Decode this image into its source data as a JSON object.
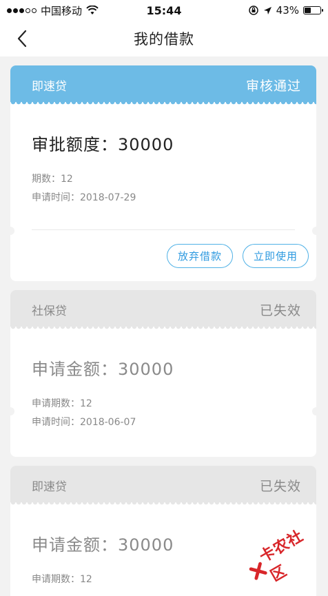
{
  "status_bar": {
    "carrier": "中国移动",
    "time": "15:44",
    "battery": "43%",
    "battery_level": 0.43
  },
  "nav": {
    "title": "我的借款"
  },
  "loans": [
    {
      "product": "即速贷",
      "status": "审核通过",
      "amount_label": "审批额度：",
      "amount": "30000",
      "term_label": "期数：",
      "term": "12",
      "date_label": "申请时间：",
      "date": "2018-07-29",
      "actions": [
        "放弃借款",
        "立即使用"
      ]
    },
    {
      "product": "社保贷",
      "status": "已失效",
      "amount_label": "申请金额：",
      "amount": "30000",
      "term_label": "申请期数：",
      "term": "12",
      "date_label": "申请时间：",
      "date": "2018-06-07"
    },
    {
      "product": "即速贷",
      "status": "已失效",
      "amount_label": "申请金额：",
      "amount": "30000",
      "term_label": "申请期数：",
      "term": "12"
    }
  ],
  "watermark": {
    "text": "卡农社区"
  },
  "colors": {
    "active_header": "#6dbbe6",
    "expired_header": "#e6e6e6",
    "button_border": "#4fb1e6",
    "watermark_red": "#d8262a"
  }
}
